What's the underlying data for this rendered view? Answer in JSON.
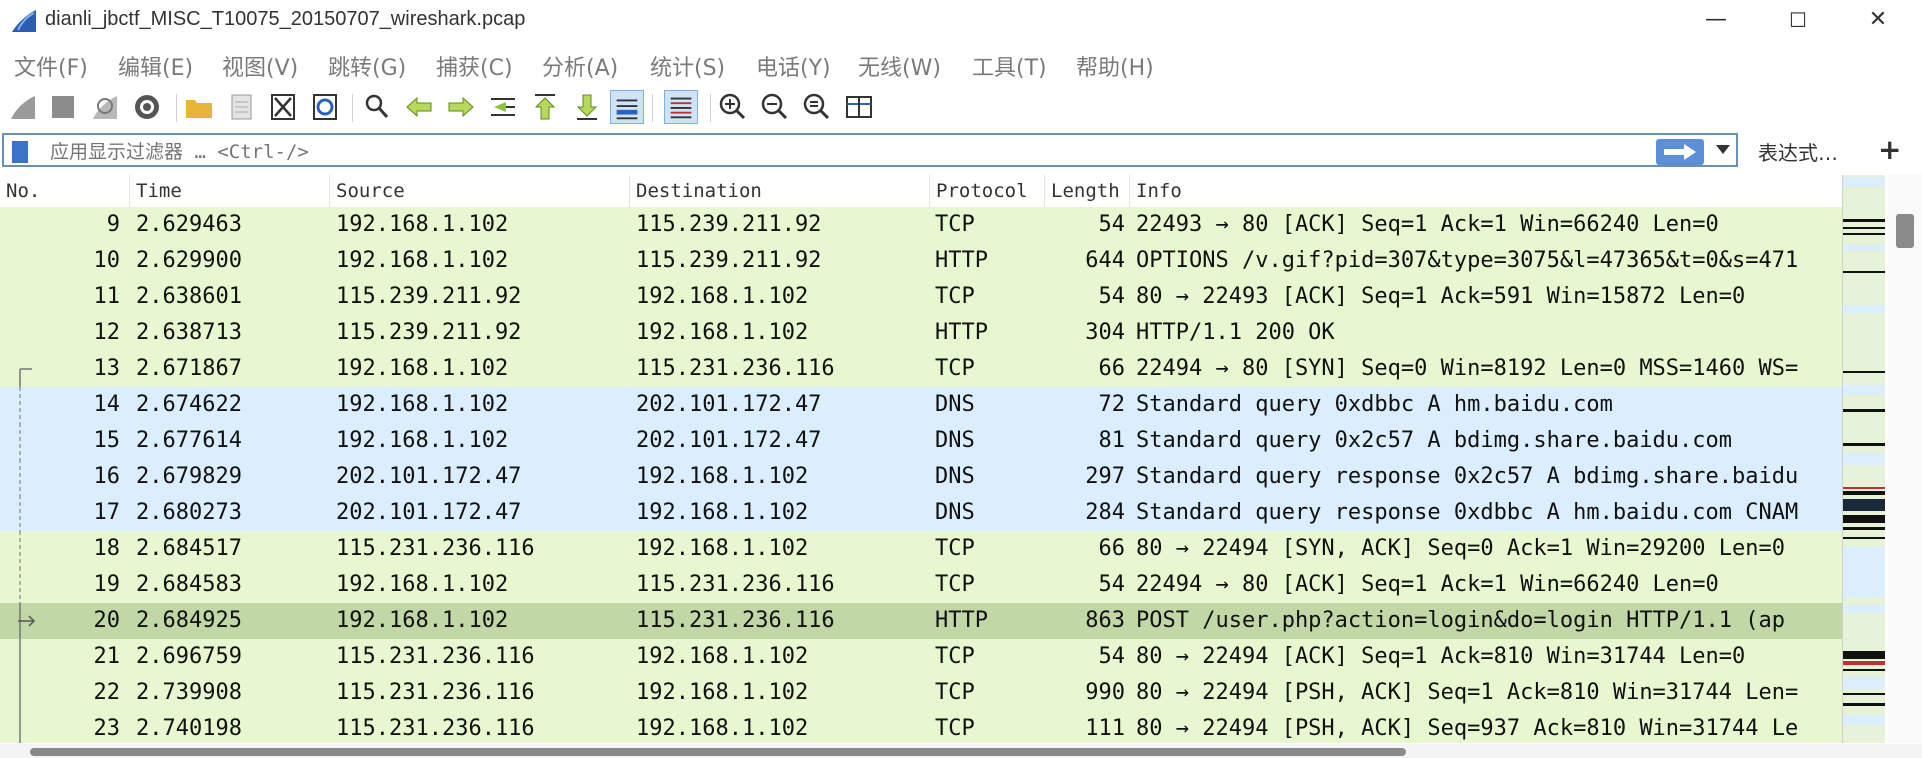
{
  "window": {
    "title": "dianli_jbctf_MISC_T10075_20150707_wireshark.pcap",
    "minimize": "—",
    "maximize": "☐",
    "close": "✕"
  },
  "menu": [
    "文件(F)",
    "编辑(E)",
    "视图(V)",
    "跳转(G)",
    "捕获(C)",
    "分析(A)",
    "统计(S)",
    "电话(Y)",
    "无线(W)",
    "工具(T)",
    "帮助(H)"
  ],
  "toolbar": {
    "icons": [
      "start-capture-icon",
      "stop-capture-icon",
      "restart-capture-icon",
      "capture-options-icon",
      "open-file-icon",
      "save-file-icon",
      "close-file-icon",
      "reload-file-icon",
      "find-packet-icon",
      "go-back-icon",
      "go-forward-icon",
      "go-to-packet-icon",
      "first-packet-icon",
      "last-packet-icon",
      "auto-scroll-icon",
      "colorize-icon",
      "zoom-in-icon",
      "zoom-out-icon",
      "normal-size-icon",
      "resize-columns-icon"
    ]
  },
  "filter": {
    "placeholder": "应用显示过滤器 … <Ctrl-/>",
    "expression_label": "表达式…",
    "add_label": "+"
  },
  "columns": [
    "No.",
    "Time",
    "Source",
    "Destination",
    "Protocol",
    "Length",
    "Info"
  ],
  "colors": {
    "tcp_bg": "#e7f7d0",
    "dns_bg": "#daeeff",
    "selected_bg": "#c2d7a6",
    "accent": "#3b73c8"
  },
  "packets": [
    {
      "no": "9",
      "time": "2.629463",
      "src": "192.168.1.102",
      "dst": "115.239.211.92",
      "proto": "TCP",
      "len": "54",
      "info": "22493 → 80 [ACK] Seq=1 Ack=1 Win=66240 Len=0",
      "color": "tcp"
    },
    {
      "no": "10",
      "time": "2.629900",
      "src": "192.168.1.102",
      "dst": "115.239.211.92",
      "proto": "HTTP",
      "len": "644",
      "info": "OPTIONS /v.gif?pid=307&type=3075&l=47365&t=0&s=471",
      "color": "tcp"
    },
    {
      "no": "11",
      "time": "2.638601",
      "src": "115.239.211.92",
      "dst": "192.168.1.102",
      "proto": "TCP",
      "len": "54",
      "info": "80 → 22493 [ACK] Seq=1 Ack=591 Win=15872 Len=0",
      "color": "tcp"
    },
    {
      "no": "12",
      "time": "2.638713",
      "src": "115.239.211.92",
      "dst": "192.168.1.102",
      "proto": "HTTP",
      "len": "304",
      "info": "HTTP/1.1 200 OK",
      "color": "tcp"
    },
    {
      "no": "13",
      "time": "2.671867",
      "src": "192.168.1.102",
      "dst": "115.231.236.116",
      "proto": "TCP",
      "len": "66",
      "info": "22494 → 80 [SYN] Seq=0 Win=8192 Len=0 MSS=1460 WS=",
      "color": "tcp"
    },
    {
      "no": "14",
      "time": "2.674622",
      "src": "192.168.1.102",
      "dst": "202.101.172.47",
      "proto": "DNS",
      "len": "72",
      "info": "Standard query 0xdbbc A hm.baidu.com",
      "color": "dns"
    },
    {
      "no": "15",
      "time": "2.677614",
      "src": "192.168.1.102",
      "dst": "202.101.172.47",
      "proto": "DNS",
      "len": "81",
      "info": "Standard query 0x2c57 A bdimg.share.baidu.com",
      "color": "dns"
    },
    {
      "no": "16",
      "time": "2.679829",
      "src": "202.101.172.47",
      "dst": "192.168.1.102",
      "proto": "DNS",
      "len": "297",
      "info": "Standard query response 0x2c57 A bdimg.share.baidu",
      "color": "dns"
    },
    {
      "no": "17",
      "time": "2.680273",
      "src": "202.101.172.47",
      "dst": "192.168.1.102",
      "proto": "DNS",
      "len": "284",
      "info": "Standard query response 0xdbbc A hm.baidu.com CNAM",
      "color": "dns"
    },
    {
      "no": "18",
      "time": "2.684517",
      "src": "115.231.236.116",
      "dst": "192.168.1.102",
      "proto": "TCP",
      "len": "66",
      "info": "80 → 22494 [SYN, ACK] Seq=0 Ack=1 Win=29200 Len=0",
      "color": "tcp"
    },
    {
      "no": "19",
      "time": "2.684583",
      "src": "192.168.1.102",
      "dst": "115.231.236.116",
      "proto": "TCP",
      "len": "54",
      "info": "22494 → 80 [ACK] Seq=1 Ack=1 Win=66240 Len=0",
      "color": "tcp"
    },
    {
      "no": "20",
      "time": "2.684925",
      "src": "192.168.1.102",
      "dst": "115.231.236.116",
      "proto": "HTTP",
      "len": "863",
      "info": "POST /user.php?action=login&do=login HTTP/1.1  (ap",
      "color": "selected"
    },
    {
      "no": "21",
      "time": "2.696759",
      "src": "115.231.236.116",
      "dst": "192.168.1.102",
      "proto": "TCP",
      "len": "54",
      "info": "80 → 22494 [ACK] Seq=1 Ack=810 Win=31744 Len=0",
      "color": "tcp"
    },
    {
      "no": "22",
      "time": "2.739908",
      "src": "115.231.236.116",
      "dst": "192.168.1.102",
      "proto": "TCP",
      "len": "990",
      "info": "80 → 22494 [PSH, ACK] Seq=1 Ack=810 Win=31744 Len=",
      "color": "tcp"
    },
    {
      "no": "23",
      "time": "2.740198",
      "src": "115.231.236.116",
      "dst": "192.168.1.102",
      "proto": "TCP",
      "len": "111",
      "info": "80 → 22494 [PSH, ACK] Seq=937 Ack=810 Win=31744 Le",
      "color": "tcp"
    }
  ]
}
